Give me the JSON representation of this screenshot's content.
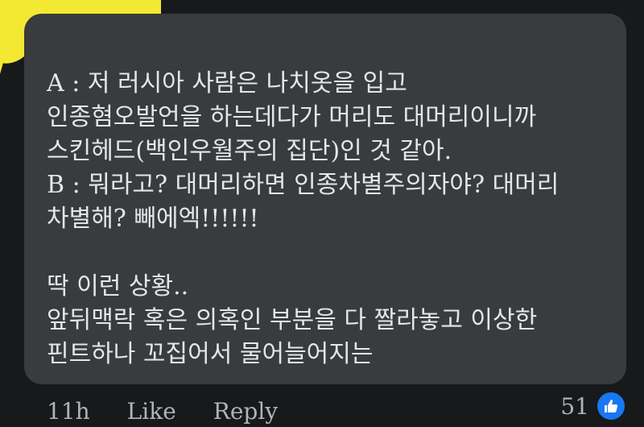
{
  "comment": {
    "lines": [
      "A : 저 러시아 사람은 나치옷을 입고",
      "인종혐오발언을 하는데다가 머리도 대머리이니까",
      "스킨헤드(백인우월주의 집단)인 것 같아.",
      "B : 뭐라고? 대머리하면 인종차별주의자야? 대머리",
      "차별해? 빼에엑!!!!!!",
      "",
      "딱 이런 상황..",
      "앞뒤맥락 혹은 의혹인 부분을 다 짤라놓고 이상한",
      "핀트하나 꼬집어서 물어늘어지는"
    ]
  },
  "footer": {
    "time": "11h",
    "like_label": "Like",
    "reply_label": "Reply"
  },
  "reactions": {
    "count": "51",
    "icon": "thumbs-up-icon"
  },
  "colors": {
    "background": "#18191a",
    "bubble": "#3a3b3c",
    "text": "#e4e6eb",
    "meta_text": "#b0b3b8",
    "like_blue": "#1877f2",
    "highlight": "#f3e932"
  }
}
